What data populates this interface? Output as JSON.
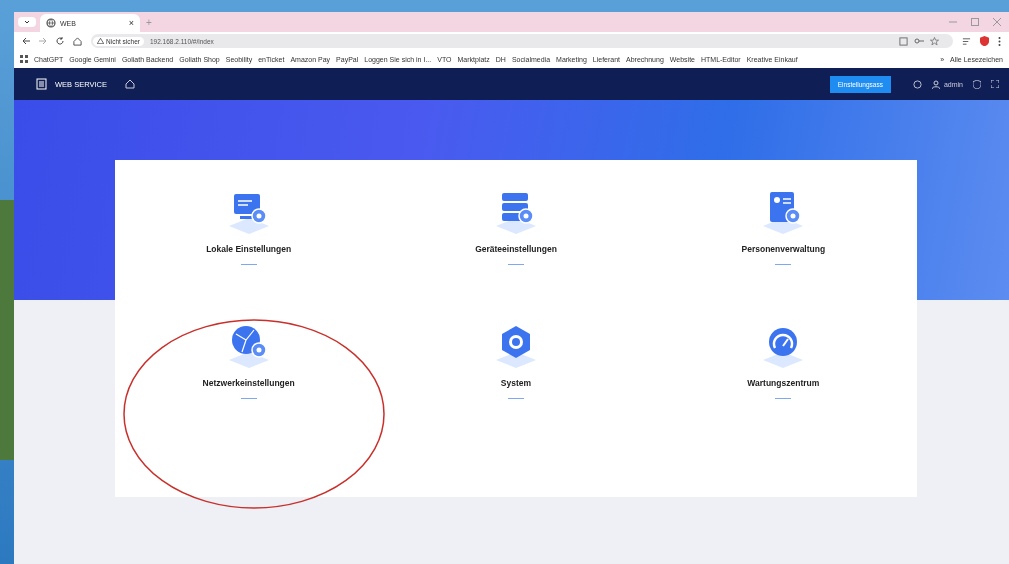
{
  "browser": {
    "tab": {
      "title": "WEB",
      "close": "×",
      "new_tab": "+"
    },
    "address": {
      "security": "Nicht sicher",
      "url": "192.168.2.110/#/index"
    },
    "bookmarks": [
      "ChatGPT",
      "Google Gemini",
      "Goliath Backend",
      "Goliath Shop",
      "Seobility",
      "enTicket",
      "Amazon Pay",
      "PayPal",
      "Loggen Sie sich in I...",
      "VTO",
      "Marktplatz",
      "DH",
      "Socialmedia",
      "Marketing",
      "Lieferant",
      "Abrechnung",
      "Website",
      "HTML-Editor",
      "Kreative Einkauf"
    ],
    "bookmarks_more": "»",
    "all_bookmarks": "Alle Lesezeichen"
  },
  "app": {
    "brand": "WEB SERVICE",
    "wizard_button": "Einstellungsass",
    "user": "admin"
  },
  "tiles": [
    {
      "kind": "monitor",
      "label": "Lokale Einstellungen",
      "highlighted": false
    },
    {
      "kind": "server",
      "label": "Geräteeinstellungen",
      "highlighted": false
    },
    {
      "kind": "person",
      "label": "Personenverwaltung",
      "highlighted": false
    },
    {
      "kind": "globe",
      "label": "Netzwerkeinstellungen",
      "highlighted": true
    },
    {
      "kind": "system",
      "label": "System",
      "highlighted": false
    },
    {
      "kind": "gauge",
      "label": "Wartungszentrum",
      "highlighted": false
    }
  ]
}
